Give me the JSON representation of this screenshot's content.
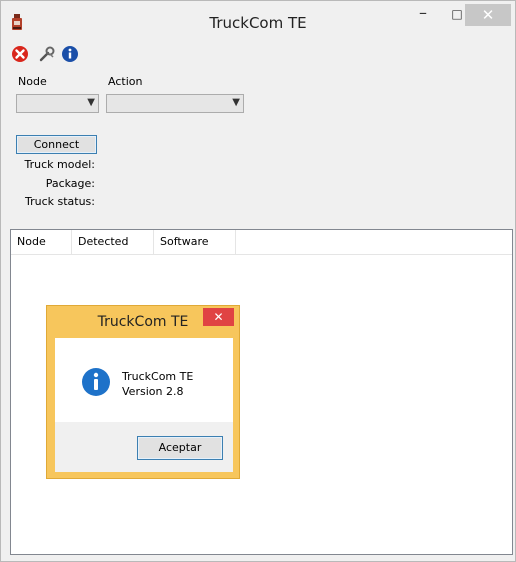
{
  "window": {
    "title": "TruckCom TE",
    "min_glyph": "–",
    "max_glyph": "□",
    "close_glyph": "✕"
  },
  "toolbar": {
    "icons": [
      "close-red-icon",
      "wrench-icon",
      "info-icon"
    ]
  },
  "form": {
    "node_label": "Node",
    "action_label": "Action",
    "node_value": "",
    "action_value": "",
    "connect_label": "Connect",
    "truck_model_label": "Truck model:",
    "package_label": "Package:",
    "truck_status_label": "Truck status:"
  },
  "grid": {
    "columns": [
      "Node",
      "Detected",
      "Software"
    ]
  },
  "dialog": {
    "title": "TruckCom TE",
    "close_glyph": "✕",
    "line1": "TruckCom TE",
    "line2": "Version 2.8",
    "ok_label": "Aceptar",
    "accent_color": "#f7c65c"
  }
}
